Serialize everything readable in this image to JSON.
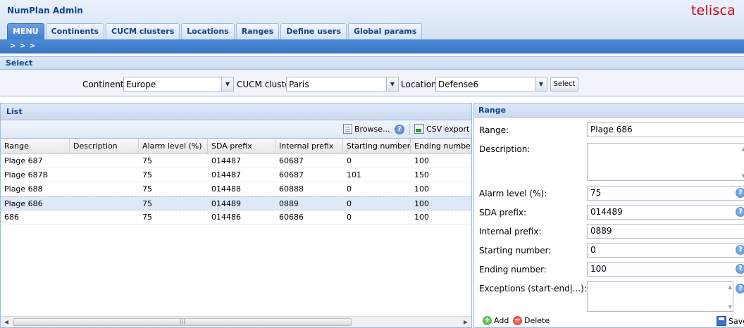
{
  "app": {
    "title": "NumPlan Admin",
    "brand": "telisca"
  },
  "tabs": [
    {
      "label": "MENU"
    },
    {
      "label": "Continents"
    },
    {
      "label": "CUCM clusters"
    },
    {
      "label": "Locations"
    },
    {
      "label": "Ranges"
    },
    {
      "label": "Define users"
    },
    {
      "label": "Global params"
    }
  ],
  "nav_strip": {
    "label": "> > >"
  },
  "select_panel": {
    "title": "Select",
    "continent_label": "Continent",
    "continent_value": "Europe",
    "cluster_label": "CUCM cluster",
    "cluster_value": "Paris",
    "location_label": "Location",
    "location_value": "Defense6",
    "select_button": "Select"
  },
  "list_panel": {
    "title": "List",
    "browse_label": "Browse...",
    "csv_label": "CSV export",
    "columns": [
      "Range",
      "Description",
      "Alarm level (%)",
      "SDA prefix",
      "Internal prefix",
      "Starting number",
      "Ending number"
    ],
    "rows": [
      [
        "Plage 687",
        "",
        "75",
        "014487",
        "60687",
        "0",
        "100"
      ],
      [
        "Plage 687B",
        "",
        "75",
        "014487",
        "60687",
        "101",
        "150"
      ],
      [
        "Plage 688",
        "",
        "75",
        "014488",
        "60888",
        "0",
        "100"
      ],
      [
        "Plage 686",
        "",
        "75",
        "014489",
        "0889",
        "0",
        "100"
      ],
      [
        "686",
        "",
        "75",
        "014486",
        "60686",
        "0",
        "100"
      ]
    ],
    "selected_row": 3
  },
  "range_form": {
    "title": "Range",
    "range_label": "Range:",
    "range_value": "Plage 686",
    "description_label": "Description:",
    "description_value": "",
    "alarm_label": "Alarm level (%):",
    "alarm_value": "75",
    "sda_label": "SDA prefix:",
    "sda_value": "014489",
    "internal_label": "Internal prefix:",
    "internal_value": "0889",
    "start_label": "Starting number:",
    "start_value": "0",
    "end_label": "Ending number:",
    "end_value": "100",
    "exceptions_label": "Exceptions (start-end|...):",
    "exceptions_value": "",
    "add_label": "Add",
    "delete_label": "Delete",
    "save_label": "Save"
  },
  "icons": {
    "browse": "document-icon",
    "help": "help-icon",
    "csv": "csv-export-icon",
    "add": "add-icon",
    "delete": "delete-icon",
    "save": "save-icon"
  },
  "colors": {
    "brand": "#d0021b",
    "accent": "#3f7fd1",
    "header_text": "#15428b"
  }
}
